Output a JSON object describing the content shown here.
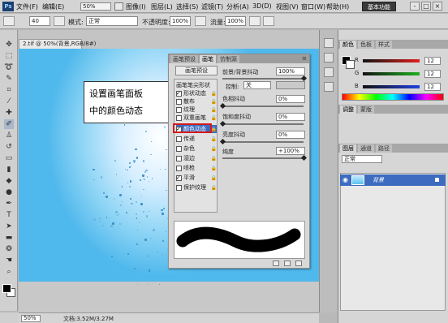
{
  "menubar": {
    "logo": "Ps",
    "items": [
      "文件(F)",
      "编辑(E)",
      "图像(I)",
      "图层(L)",
      "选择(S)",
      "滤镜(T)",
      "分析(A)",
      "3D(D)",
      "视图(V)",
      "窗口(W)",
      "帮助(H)"
    ],
    "zoom": "50%",
    "workspace": "基本功能",
    "window_buttons": [
      "-",
      "□",
      "×"
    ]
  },
  "options": {
    "brush_size": "40",
    "mode_label": "模式:",
    "mode_value": "正常",
    "opacity_label": "不透明度:",
    "opacity_value": "100%",
    "flow_label": "流量:",
    "flow_value": "100%"
  },
  "document": {
    "tab_title": "2.tif @ 50%(背景,RGB/8#)",
    "zoom": "50%",
    "file_info": "文档:3.52M/3.27M"
  },
  "callout": {
    "line1": "设置画笔面板",
    "line2": "中的颜色动态"
  },
  "brush_panel": {
    "tabs": [
      "画笔预设",
      "画笔",
      "仿制源"
    ],
    "active_tab": "画笔",
    "presets_button": "画笔预设",
    "list_header": "画笔笔尖形状",
    "items": [
      {
        "label": "形状动态",
        "checked": true
      },
      {
        "label": "散布",
        "checked": false
      },
      {
        "label": "纹理",
        "checked": false
      },
      {
        "label": "双重画笔",
        "checked": false
      },
      {
        "label": "颜色动态",
        "checked": true
      },
      {
        "label": "传递",
        "checked": false
      },
      {
        "label": "杂色",
        "checked": false
      },
      {
        "label": "湿边",
        "checked": false
      },
      {
        "label": "喷枪",
        "checked": false
      },
      {
        "label": "平滑",
        "checked": true
      },
      {
        "label": "保护纹理",
        "checked": false
      }
    ],
    "params": {
      "fg_bg_jitter_label": "前景/背景抖动",
      "fg_bg_jitter_value": "100%",
      "control_label": "控制:",
      "control_value": "关",
      "hue_label": "色相抖动",
      "hue_value": "0%",
      "saturation_label": "饱和度抖动",
      "saturation_value": "0%",
      "brightness_label": "亮度抖动",
      "brightness_value": "0%",
      "purity_label": "纯度",
      "purity_value": "+100%"
    }
  },
  "color_panel": {
    "tabs": [
      "颜色",
      "色板",
      "样式"
    ],
    "channels": [
      {
        "name": "R",
        "value": "12",
        "color": "#e02020"
      },
      {
        "name": "G",
        "value": "12",
        "color": "#20b020"
      },
      {
        "name": "B",
        "value": "12",
        "color": "#2040e0"
      }
    ]
  },
  "layers_panel": {
    "tabs": [
      "调整",
      "蒙版"
    ],
    "tabs2": [
      "图层",
      "通道",
      "路径"
    ],
    "mode": "正常",
    "layer_name": "背景"
  }
}
